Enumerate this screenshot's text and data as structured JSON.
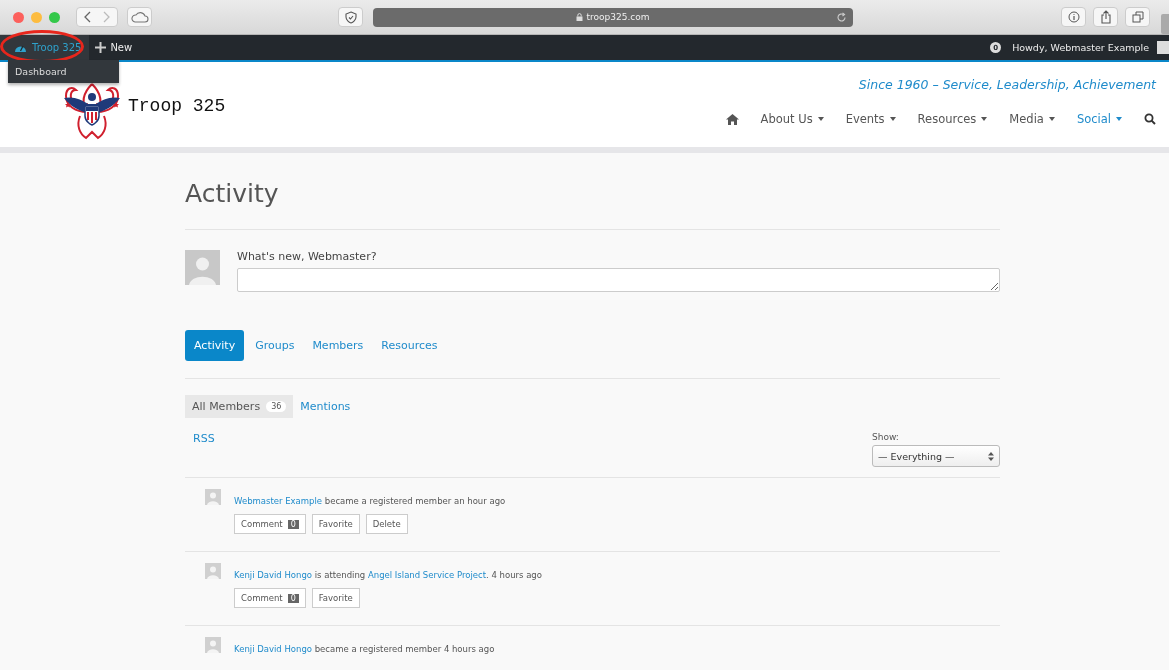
{
  "browser": {
    "address": "troop325.com"
  },
  "admin_bar": {
    "site": "Troop 325",
    "highlighted": true,
    "new": "New",
    "dropdown": [
      "Dashboard"
    ],
    "notifications": "0",
    "greeting": "Howdy, Webmaster Example"
  },
  "header": {
    "logo_text": "Troop 325",
    "tagline": "Since 1960 – Service, Leadership, Achievement",
    "nav": [
      {
        "label": "About Us",
        "selected": false
      },
      {
        "label": "Events",
        "selected": false
      },
      {
        "label": "Resources",
        "selected": false
      },
      {
        "label": "Media",
        "selected": false
      },
      {
        "label": "Social",
        "selected": true
      }
    ]
  },
  "page": {
    "title": "Activity",
    "post_label": "What's new, Webmaster?",
    "tabs": [
      {
        "label": "Activity",
        "selected": true
      },
      {
        "label": "Groups",
        "selected": false
      },
      {
        "label": "Members",
        "selected": false
      },
      {
        "label": "Resources",
        "selected": false
      }
    ],
    "filters": [
      {
        "label": "All Members",
        "count": "36",
        "selected": true
      },
      {
        "label": "Mentions",
        "selected": false
      }
    ],
    "rss": "RSS",
    "show_label": "Show:",
    "show_value": "— Everything —",
    "items": [
      {
        "parts": [
          {
            "text": "Webmaster Example",
            "link": true
          },
          {
            "text": " became a registered member an hour ago",
            "link": false
          }
        ],
        "buttons": [
          {
            "label": "Comment",
            "count": "0"
          },
          {
            "label": "Favorite"
          },
          {
            "label": "Delete"
          }
        ]
      },
      {
        "parts": [
          {
            "text": "Kenji David Hongo",
            "link": true
          },
          {
            "text": " is attending ",
            "link": false
          },
          {
            "text": "Angel Island Service Project",
            "link": true
          },
          {
            "text": ". 4 hours ago",
            "link": false
          }
        ],
        "buttons": [
          {
            "label": "Comment",
            "count": "0"
          },
          {
            "label": "Favorite"
          }
        ]
      },
      {
        "parts": [
          {
            "text": "Kenji David Hongo",
            "link": true
          },
          {
            "text": " became a registered member 4 hours ago",
            "link": false
          }
        ]
      }
    ]
  }
}
